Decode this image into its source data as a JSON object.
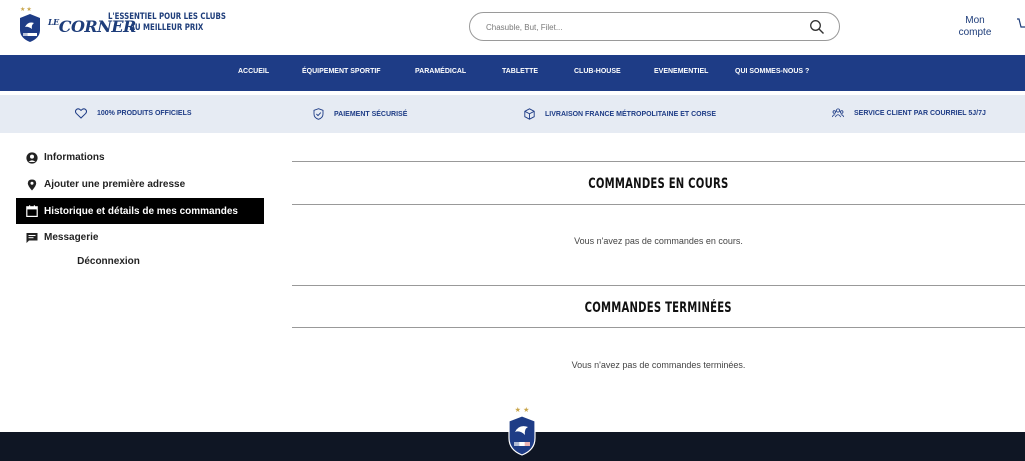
{
  "header": {
    "tagline_line1": "L'ESSENTIEL POUR LES CLUBS",
    "tagline_line2": "AU MEILLEUR PRIX",
    "logo_text": "CORNER",
    "logo_prefix": "LE",
    "search_placeholder": "Chasuble, But, Filet...",
    "account_line1": "Mon",
    "account_line2": "compte"
  },
  "nav": {
    "items": [
      {
        "label": "ACCUEIL"
      },
      {
        "label": "ÉQUIPEMENT SPORTIF"
      },
      {
        "label": "PARAMÉDICAL"
      },
      {
        "label": "TABLETTE"
      },
      {
        "label": "CLUB-HOUSE"
      },
      {
        "label": "EVENEMENTIEL"
      },
      {
        "label": "QUI SOMMES-NOUS ?"
      }
    ]
  },
  "reassurance": {
    "items": [
      {
        "label": "100% PRODUITS OFFICIELS",
        "icon": "heart-icon"
      },
      {
        "label": "PAIEMENT SÉCURISÉ",
        "icon": "shield-check-icon"
      },
      {
        "label": "LIVRAISON FRANCE MÉTROPOLITAINE ET CORSE",
        "icon": "package-icon"
      },
      {
        "label": "SERVICE CLIENT PAR COURRIEL 5J/7J",
        "icon": "people-icon"
      }
    ]
  },
  "sidebar": {
    "items": [
      {
        "label": "Informations",
        "icon": "user-circle-icon"
      },
      {
        "label": "Ajouter une première adresse",
        "icon": "map-pin-icon"
      },
      {
        "label": "Historique et détails de mes commandes",
        "icon": "calendar-icon",
        "active": true
      },
      {
        "label": "Messagerie",
        "icon": "message-icon"
      }
    ],
    "logout_label": "Déconnexion"
  },
  "main": {
    "current_title": "COMMANDES EN COURS",
    "current_empty": "Vous n'avez pas de commandes en cours.",
    "finished_title": "COMMANDES TERMINÉES",
    "finished_empty": "Vous n'avez pas de commandes terminées."
  },
  "colors": {
    "brand_blue": "#1e3c86",
    "reassurance_bg": "#e6ebf3",
    "footer_bg": "#0f1624",
    "active_bg": "#000000"
  }
}
